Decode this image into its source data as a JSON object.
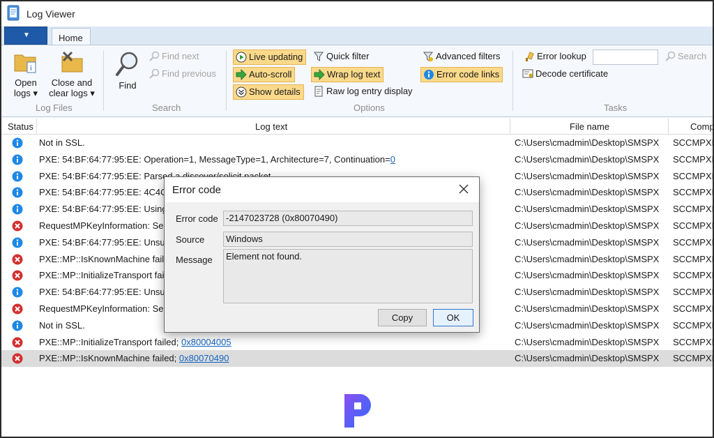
{
  "window": {
    "title": "Log Viewer"
  },
  "ribbon": {
    "home_tab": "Home",
    "log_files": {
      "label": "Log Files",
      "open_logs": "Open logs ▾",
      "close_logs": "Close and clear logs ▾"
    },
    "search": {
      "label": "Search",
      "find": "Find",
      "find_next": "Find next",
      "find_previous": "Find previous"
    },
    "options": {
      "label": "Options",
      "live_updating": "Live updating",
      "auto_scroll": "Auto-scroll",
      "show_details": "Show details",
      "quick_filter": "Quick filter",
      "wrap_log_text": "Wrap log text",
      "raw_log_entry": "Raw log entry display",
      "advanced_filters": "Advanced filters",
      "error_code_links": "Error code links"
    },
    "tasks": {
      "label": "Tasks",
      "error_lookup": "Error lookup",
      "search": "Search",
      "decode_certificate": "Decode certificate",
      "error_lookup_value": ""
    }
  },
  "table": {
    "columns": {
      "status": "Status",
      "log_text": "Log text",
      "file_name": "File name",
      "component": "Comp"
    },
    "rows": [
      {
        "status": "info",
        "text": "Not in SSL.",
        "link": "",
        "file": "C:\\Users\\cmadmin\\Desktop\\SMSPX",
        "comp": "SCCMPXE"
      },
      {
        "status": "info",
        "text": "PXE: 54:BF:64:77:95:EE: Operation=1, MessageType=1, Architecture=7, Continuation=",
        "link": "0",
        "file": "C:\\Users\\cmadmin\\Desktop\\SMSPX",
        "comp": "SCCMPXE"
      },
      {
        "status": "info",
        "text": "PXE: 54:BF:64:77:95:EE: Parsed a discover/solicit packet.",
        "link": "",
        "file": "C:\\Users\\cmadmin\\Desktop\\SMSPX",
        "comp": "SCCMPXE"
      },
      {
        "status": "info",
        "text": "PXE: 54:BF:64:77:95:EE: 4C4C4",
        "link": "",
        "file": "C:\\Users\\cmadmin\\Desktop\\SMSPX",
        "comp": "SCCMPXE"
      },
      {
        "status": "info",
        "text": "PXE: 54:BF:64:77:95:EE: Using I",
        "link": "",
        "file": "C:\\Users\\cmadmin\\Desktop\\SMSPX",
        "comp": "SCCMPXE"
      },
      {
        "status": "error",
        "text": "RequestMPKeyInformation: Se",
        "link": "",
        "file": "C:\\Users\\cmadmin\\Desktop\\SMSPX",
        "comp": "SCCMPXE"
      },
      {
        "status": "info",
        "text": "PXE: 54:BF:64:77:95:EE: Unsuc",
        "link": "",
        "file": "C:\\Users\\cmadmin\\Desktop\\SMSPX",
        "comp": "SCCMPXE"
      },
      {
        "status": "error",
        "text": "PXE::MP::IsKnownMachine fail",
        "link": "",
        "file": "C:\\Users\\cmadmin\\Desktop\\SMSPX",
        "comp": "SCCMPXE"
      },
      {
        "status": "error",
        "text": "PXE::MP::InitializeTransport fai",
        "link": "",
        "file": "C:\\Users\\cmadmin\\Desktop\\SMSPX",
        "comp": "SCCMPXE"
      },
      {
        "status": "info",
        "text": "PXE: 54:BF:64:77:95:EE: Unsuc",
        "link": "",
        "file": "C:\\Users\\cmadmin\\Desktop\\SMSPX",
        "comp": "SCCMPXE"
      },
      {
        "status": "error",
        "text": "RequestMPKeyInformation: Se",
        "link": "",
        "file": "C:\\Users\\cmadmin\\Desktop\\SMSPX",
        "comp": "SCCMPXE"
      },
      {
        "status": "info",
        "text": "Not in SSL.",
        "link": "",
        "file": "C:\\Users\\cmadmin\\Desktop\\SMSPX",
        "comp": "SCCMPXE"
      },
      {
        "status": "error",
        "text": "PXE::MP::InitializeTransport failed; ",
        "link": "0x80004005",
        "file": "C:\\Users\\cmadmin\\Desktop\\SMSPX",
        "comp": "SCCMPXE"
      },
      {
        "status": "error",
        "text": "PXE::MP::IsKnownMachine failed; ",
        "link": "0x80070490",
        "file": "C:\\Users\\cmadmin\\Desktop\\SMSPX",
        "comp": "SCCMPXE",
        "selected": true
      }
    ]
  },
  "dialog": {
    "title": "Error code",
    "error_code_label": "Error code",
    "error_code_value": "-2147023728 (0x80070490)",
    "source_label": "Source",
    "source_value": "Windows",
    "message_label": "Message",
    "message_value": "Element not found.",
    "copy_button": "Copy",
    "ok_button": "OK"
  },
  "colors": {
    "accent": "#1e5aa8",
    "toggle_on": "#fbd98a",
    "info": "#1e88e5",
    "error": "#d32f2f",
    "link": "#1565c0"
  }
}
